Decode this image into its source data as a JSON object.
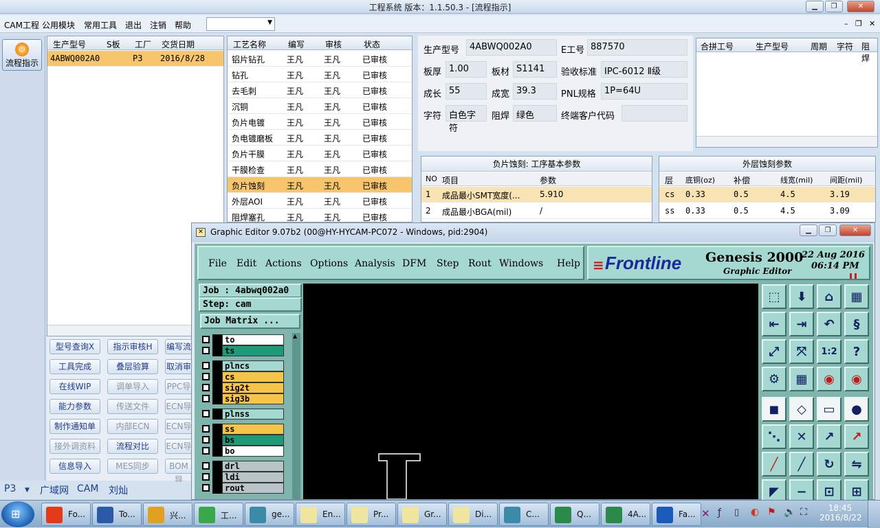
{
  "app": {
    "title": "工程系统   版本：1.1.50.3 - [流程指示]",
    "menu": [
      "CAM工程",
      "公用模块",
      "常用工具",
      "退出",
      "注销",
      "帮助"
    ],
    "combo_value": ""
  },
  "sidebar": {
    "flow_button": "流程指示"
  },
  "products": {
    "columns": [
      "生产型号",
      "S板",
      "工厂",
      "交货日期"
    ],
    "rows": [
      {
        "model": "4ABWQ002A0",
        "s": "",
        "factory": "P3",
        "date": "2016/8/28"
      }
    ]
  },
  "processes": {
    "columns": [
      "工艺名称",
      "编写",
      "审核",
      "状态"
    ],
    "rows": [
      {
        "name": "铝片钻孔",
        "writer": "王凡",
        "reviewer": "王凡",
        "status": "已审核"
      },
      {
        "name": "钻孔",
        "writer": "王凡",
        "reviewer": "王凡",
        "status": "已审核"
      },
      {
        "name": "去毛刺",
        "writer": "王凡",
        "reviewer": "王凡",
        "status": "已审核"
      },
      {
        "name": "沉铜",
        "writer": "王凡",
        "reviewer": "王凡",
        "status": "已审核"
      },
      {
        "name": "负片电镀",
        "writer": "王凡",
        "reviewer": "王凡",
        "status": "已审核"
      },
      {
        "name": "负电镀磨板",
        "writer": "王凡",
        "reviewer": "王凡",
        "status": "已审核"
      },
      {
        "name": "负片干膜",
        "writer": "王凡",
        "reviewer": "王凡",
        "status": "已审核"
      },
      {
        "name": "干膜检查",
        "writer": "王凡",
        "reviewer": "王凡",
        "status": "已审核"
      },
      {
        "name": "负片蚀刻",
        "writer": "王凡",
        "reviewer": "王凡",
        "status": "已审核"
      },
      {
        "name": "外层AOI",
        "writer": "王凡",
        "reviewer": "王凡",
        "status": "已审核"
      },
      {
        "name": "阻焊塞孔",
        "writer": "王凡",
        "reviewer": "王凡",
        "status": "已审核"
      }
    ]
  },
  "buttons": {
    "col1": [
      "型号查询X",
      "工具完成",
      "在线WIP",
      "能力参数",
      "制作通知单",
      "接外调资料",
      "信息导入"
    ],
    "col2": [
      "指示审核H",
      "叠层验算",
      "调单导入",
      "传送文件",
      "内部ECN",
      "流程对比",
      "MES同步"
    ],
    "col3": [
      "编写流",
      "取消审",
      "PPC导",
      "ECN导",
      "ECN导",
      "ECN导",
      "BOM导"
    ]
  },
  "bottom_tabs": [
    "P3",
    "广域网",
    "CAM",
    "刘灿"
  ],
  "info": {
    "model_label": "生产型号",
    "model": "4ABWQ002A0",
    "eno_label": "E工号",
    "eno": "887570",
    "thick_label": "板厚",
    "thick": "1.00",
    "material_label": "板材",
    "material": "S1141",
    "standard_label": "验收标准",
    "standard": "IPC-6012 Ⅱ级",
    "length_label": "成长",
    "length": "55",
    "width_label": "成宽",
    "width": "39.3",
    "pnl_label": "PNL规格",
    "pnl": "1P=64U",
    "char_label": "字符",
    "char": "白色字符",
    "mask_label": "阻焊",
    "mask": "绿色",
    "cust_label": "终端客户代码",
    "cust": ""
  },
  "merge": {
    "columns": [
      "合拼工号",
      "生产型号",
      "周期",
      "字符",
      "阻焊"
    ]
  },
  "etch_basic": {
    "title": "负片蚀刻: 工序基本参数",
    "columns": [
      "NO",
      "项目",
      "参数"
    ],
    "rows": [
      {
        "no": "1",
        "item": "成品最小SMT宽度(...",
        "param": "5.910"
      },
      {
        "no": "2",
        "item": "成品最小BGA(mil)",
        "param": "/"
      }
    ]
  },
  "outer_etch": {
    "title": "外层蚀刻参数",
    "columns": [
      "层",
      "底铜(oz)",
      "补偿",
      "线宽(mil)",
      "间距(mil)"
    ],
    "rows": [
      {
        "layer": "cs",
        "cu": "0.33",
        "comp": "0.5",
        "lw": "4.5",
        "sp": "3.19"
      },
      {
        "layer": "ss",
        "cu": "0.33",
        "comp": "0.5",
        "lw": "4.5",
        "sp": "3.09"
      }
    ]
  },
  "genesis": {
    "title": "Graphic Editor 9.07b2 (00@HY-HYCAM-PC072 - Windows, pid:2904)",
    "menu": [
      "File",
      "Edit",
      "Actions",
      "Options",
      "Analysis",
      "DFM",
      "Step",
      "Rout",
      "Windows",
      "Help"
    ],
    "brand": "Frontline",
    "product": "Genesis 2000",
    "subtitle": "Graphic Editor",
    "date": "22  Aug  2016",
    "time": "06:14  PM",
    "job": "Job : 4abwq002a0",
    "step": "Step: cam",
    "job_matrix": "Job Matrix ...",
    "layers": [
      {
        "name": "to",
        "color": "#ffffff"
      },
      {
        "name": "ts",
        "color": "#1f9a78"
      },
      {
        "name": "plncs",
        "color": "#a5d8d0"
      },
      {
        "name": "cs",
        "color": "#f7c44a"
      },
      {
        "name": "sig2t",
        "color": "#f7c44a"
      },
      {
        "name": "sig3b",
        "color": "#f7c44a"
      },
      {
        "name": "plnss",
        "color": "#a5d8d0"
      },
      {
        "name": "ss",
        "color": "#f7c44a"
      },
      {
        "name": "bs",
        "color": "#1f9a78"
      },
      {
        "name": "bo",
        "color": "#ffffff"
      },
      {
        "name": "drl",
        "color": "#b9c4c8"
      },
      {
        "name": "ldi",
        "color": "#b9c4c8"
      },
      {
        "name": "rout",
        "color": "#b9c4c8"
      }
    ],
    "zoom_label": "1:2"
  },
  "taskbar": {
    "items": [
      "Fo...",
      "To...",
      "兴...",
      "工...",
      "ge...",
      "En...",
      "Pr...",
      "Gr...",
      "Di...",
      "C...",
      "Q...",
      "4A...",
      "Fa..."
    ],
    "time": "18:45",
    "date": "2016/8/22"
  }
}
